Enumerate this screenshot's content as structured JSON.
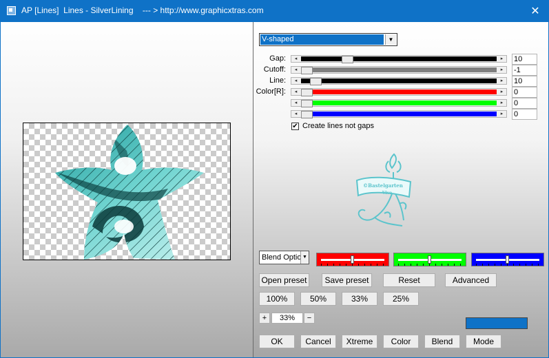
{
  "window": {
    "title": "AP [Lines]  Lines - SilverLining    --- > http://www.graphicxtras.com",
    "close_glyph": "✕",
    "accent": "#0f72c7"
  },
  "mode_select": {
    "value": "V-shaped",
    "arrow": "▼"
  },
  "sliders": [
    {
      "id": "gap",
      "label": "Gap:",
      "value": "10",
      "fraction": 0.22,
      "track_color": "#000000"
    },
    {
      "id": "cutoff",
      "label": "Cutoff:",
      "value": "-1",
      "fraction": 0.0,
      "track_color": "#7f7f7f"
    },
    {
      "id": "line",
      "label": "Line:",
      "value": "10",
      "fraction": 0.05,
      "track_color": "#000000"
    },
    {
      "id": "color-r",
      "label": "Color[R]:",
      "value": "0",
      "fraction": 0.0,
      "track_color": "#ff0000"
    },
    {
      "id": "color-g",
      "label": "",
      "value": "0",
      "fraction": 0.0,
      "track_color": "#00ff00"
    },
    {
      "id": "color-b",
      "label": "",
      "value": "0",
      "fraction": 0.0,
      "track_color": "#0000ff"
    }
  ],
  "checkbox": {
    "label": "Create lines not gaps",
    "checked": true,
    "mark": "✔"
  },
  "blend_options": {
    "value": "Blend Optio",
    "arrow": "▼"
  },
  "color_sliders": [
    {
      "id": "red",
      "color": "#ff0000",
      "fraction": 0.5
    },
    {
      "id": "green",
      "color": "#00ff00",
      "fraction": 0.5
    },
    {
      "id": "blue",
      "color": "#0000ff",
      "fraction": 0.5
    }
  ],
  "buttons": {
    "open_preset": "Open preset",
    "save_preset": "Save preset",
    "reset": "Reset",
    "advanced": "Advanced",
    "zoom_100": "100%",
    "zoom_50": "50%",
    "zoom_33": "33%",
    "zoom_25": "25%",
    "ok": "OK",
    "cancel": "Cancel",
    "xtreme": "Xtreme",
    "color": "Color",
    "blend": "Blend",
    "mode": "Mode"
  },
  "zoom": {
    "plus": "+",
    "minus": "−",
    "value": "33%"
  },
  "swatch_color": "#0f72c7",
  "logo": {
    "text_line1": "©Bastelgarten",
    "text_line2": "Vivo",
    "color": "#5bc4cc"
  }
}
